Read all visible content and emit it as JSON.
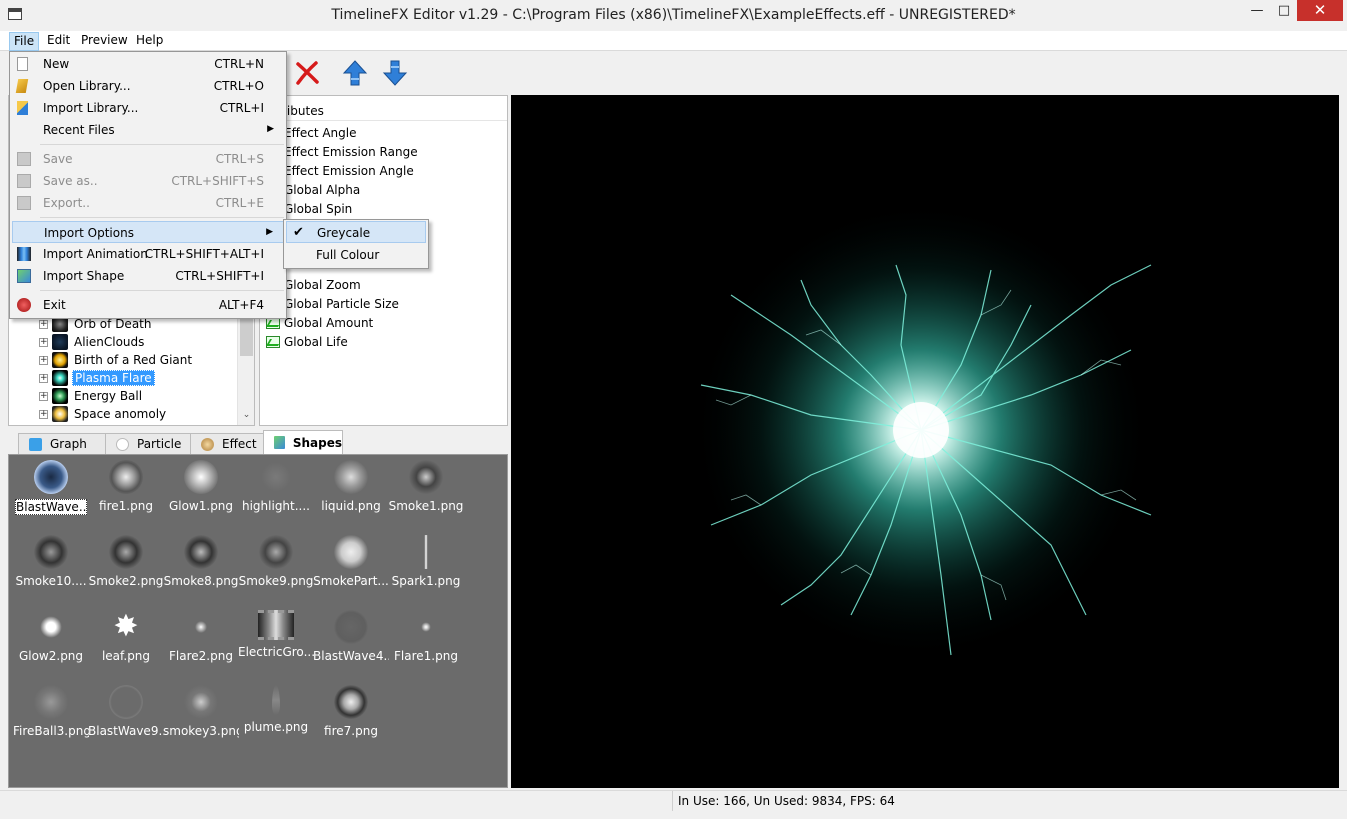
{
  "window": {
    "title": "TimelineFX Editor v1.29 - C:\\Program Files (x86)\\TimelineFX\\ExampleEffects.eff - UNREGISTERED*",
    "minimize": "—",
    "maximize": "□",
    "close": "✕"
  },
  "menubar": {
    "file": "File",
    "edit": "Edit",
    "preview": "Preview",
    "help": "Help"
  },
  "file_menu": {
    "new": {
      "label": "New",
      "shortcut": "CTRL+N"
    },
    "open_library": {
      "label": "Open Library...",
      "shortcut": "CTRL+O"
    },
    "import_library": {
      "label": "Import Library...",
      "shortcut": "CTRL+I"
    },
    "recent_files": {
      "label": "Recent Files",
      "arrow": "▶"
    },
    "save": {
      "label": "Save",
      "shortcut": "CTRL+S"
    },
    "save_as": {
      "label": "Save as..",
      "shortcut": "CTRL+SHIFT+S"
    },
    "export": {
      "label": "Export..",
      "shortcut": "CTRL+E"
    },
    "import_options": {
      "label": "Import Options",
      "arrow": "▶"
    },
    "import_animation": {
      "label": "Import Animation",
      "shortcut": "CTRL+SHIFT+ALT+I"
    },
    "import_shape": {
      "label": "Import Shape",
      "shortcut": "CTRL+SHIFT+I"
    },
    "exit": {
      "label": "Exit",
      "shortcut": "ALT+F4"
    }
  },
  "import_options_submenu": {
    "greycale": "Greycale",
    "full_colour": "Full Colour",
    "check": "✔"
  },
  "effects_tree": [
    {
      "label": "Orb of Death",
      "selected": false
    },
    {
      "label": "AlienClouds",
      "selected": false
    },
    {
      "label": "Birth of a Red Giant",
      "selected": false
    },
    {
      "label": "Plasma Flare",
      "selected": true
    },
    {
      "label": "Energy Ball",
      "selected": false
    },
    {
      "label": "Space anomoly",
      "selected": false
    }
  ],
  "attributes": {
    "header": "ributes",
    "items": [
      "Effect Angle",
      "Effect Emission Range",
      "Effect Emission Angle",
      "Global Alpha",
      "Global Spin",
      "Global Zoom",
      "Global Particle Size",
      "Global Amount",
      "Global Life"
    ]
  },
  "tabs": {
    "graph": "Graph",
    "particle": "Particle",
    "effect": "Effect",
    "shapes": "Shapes"
  },
  "shapes": [
    "BlastWave....",
    "fire1.png",
    "Glow1.png",
    "highlight....",
    "liquid.png",
    "Smoke1.png",
    "Smoke10....",
    "Smoke2.png",
    "Smoke8.png",
    "Smoke9.png",
    "SmokePart...",
    "Spark1.png",
    "Glow2.png",
    "leaf.png",
    "Flare2.png",
    "ElectricGro...",
    "BlastWave4...",
    "Flare1.png",
    "FireBall3.png",
    "BlastWave9...",
    "smokey3.png",
    "plume.png",
    "fire7.png"
  ],
  "status": {
    "text": "In Use: 166, Un Used: 9834, FPS: 64"
  },
  "colors": {
    "accent": "#3399ff",
    "close_red": "#c7302b",
    "preview_bg": "#000000",
    "flare_cyan": "#3fe0c8"
  }
}
